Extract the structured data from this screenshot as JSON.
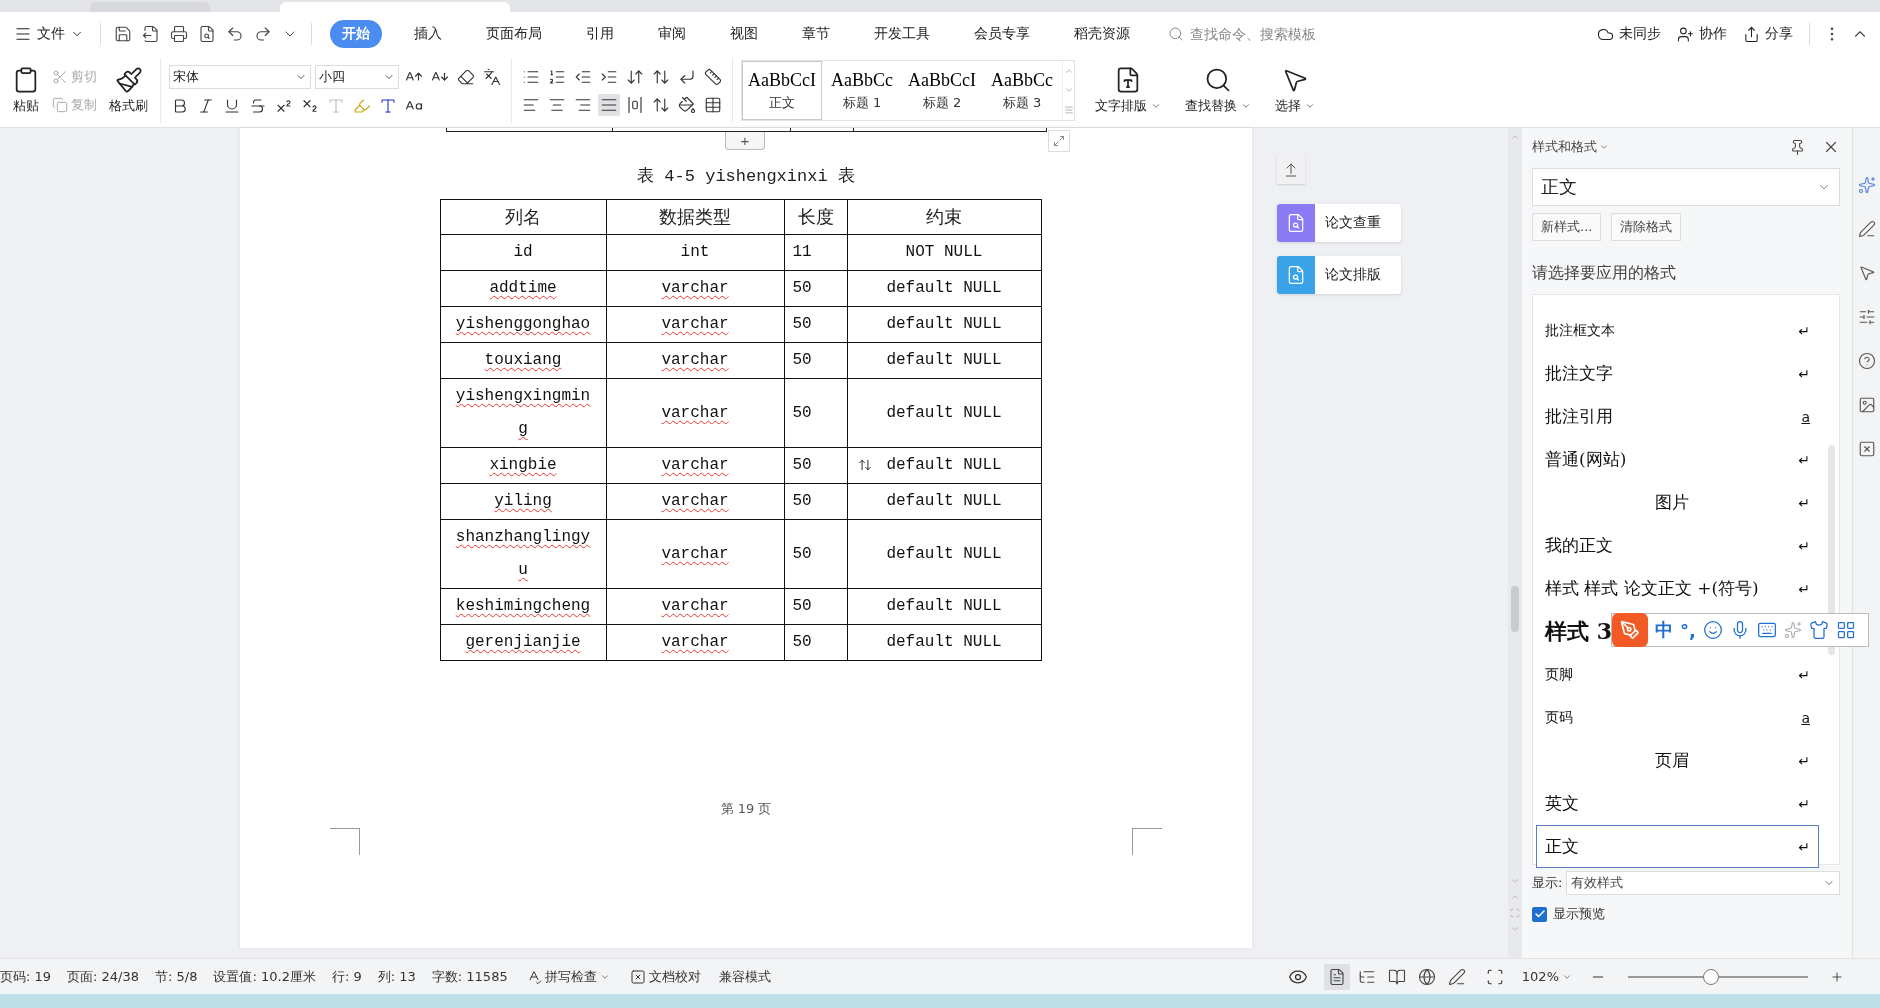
{
  "menu": {
    "file": "文件",
    "tabs": [
      {
        "label": "开始",
        "selected": true
      },
      {
        "label": "插入",
        "selected": false
      },
      {
        "label": "页面布局",
        "selected": false
      },
      {
        "label": "引用",
        "selected": false
      },
      {
        "label": "审阅",
        "selected": false
      },
      {
        "label": "视图",
        "selected": false
      },
      {
        "label": "章节",
        "selected": false
      },
      {
        "label": "开发工具",
        "selected": false
      },
      {
        "label": "会员专享",
        "selected": false
      },
      {
        "label": "稻壳资源",
        "selected": false
      }
    ],
    "search": {
      "placeholder": "查找命令、搜索模板"
    },
    "actions": [
      {
        "kind": "sync",
        "label": "未同步"
      },
      {
        "kind": "collab",
        "label": "协作"
      },
      {
        "kind": "share",
        "label": "分享"
      }
    ]
  },
  "ribbon": {
    "clipboard": {
      "paste": "粘贴",
      "cut": {
        "label": "剪切",
        "disabled": true
      },
      "copy": {
        "label": "复制",
        "disabled": true
      },
      "painter": "格式刷"
    },
    "font": {
      "name": "宋体",
      "size": "小四"
    },
    "align": [
      {
        "kind": "left",
        "selected": false
      },
      {
        "kind": "center",
        "selected": false
      },
      {
        "kind": "right",
        "selected": false
      },
      {
        "kind": "justify",
        "selected": true
      },
      {
        "kind": "distributed",
        "selected": false
      }
    ],
    "styles": [
      {
        "preview": "AaBbCcI",
        "label": "正文",
        "selected": true
      },
      {
        "preview": "AaBbCc",
        "label": "标题 1",
        "selected": false
      },
      {
        "preview": "AaBbCcI",
        "label": "标题 2",
        "selected": false
      },
      {
        "preview": "AaBbCc",
        "label": "标题 3",
        "selected": false
      }
    ],
    "tools": [
      {
        "kind": "layout",
        "label": "文字排版"
      },
      {
        "kind": "find",
        "label": "查找替换"
      },
      {
        "kind": "select",
        "label": "选择"
      }
    ]
  },
  "document": {
    "add_row": "+",
    "caption": "表 4-5 yishengxinxi 表",
    "columns": [
      "列名",
      "数据类型",
      "长度",
      "约束"
    ],
    "rows": [
      [
        {
          "text": "id",
          "flagged": false
        },
        {
          "text": "int",
          "flagged": false
        },
        {
          "text": "11",
          "flagged": false
        },
        {
          "text": "NOT NULL",
          "flagged": false
        }
      ],
      [
        {
          "text": "addtime",
          "flagged": true
        },
        {
          "text": "varchar",
          "flagged": true
        },
        {
          "text": "50",
          "flagged": false
        },
        {
          "text": "default NULL",
          "flagged": false
        }
      ],
      [
        {
          "text": "yishenggonghao",
          "flagged": true
        },
        {
          "text": "varchar",
          "flagged": true
        },
        {
          "text": "50",
          "flagged": false
        },
        {
          "text": "default NULL",
          "flagged": false
        }
      ],
      [
        {
          "text": "touxiang",
          "flagged": true
        },
        {
          "text": "varchar",
          "flagged": true
        },
        {
          "text": "50",
          "flagged": false
        },
        {
          "text": "default NULL",
          "flagged": false
        }
      ],
      [
        {
          "text": "yishengxingming",
          "flagged": true
        },
        {
          "text": "varchar",
          "flagged": true
        },
        {
          "text": "50",
          "flagged": false
        },
        {
          "text": "default NULL",
          "flagged": false
        }
      ],
      [
        {
          "text": "xingbie",
          "flagged": true
        },
        {
          "text": "varchar",
          "flagged": true
        },
        {
          "text": "50",
          "flagged": false
        },
        {
          "text": "default NULL",
          "flagged": false
        }
      ],
      [
        {
          "text": "yiling",
          "flagged": true
        },
        {
          "text": "varchar",
          "flagged": true
        },
        {
          "text": "50",
          "flagged": false
        },
        {
          "text": "default NULL",
          "flagged": false
        }
      ],
      [
        {
          "text": "shanzhanglingyu",
          "flagged": true
        },
        {
          "text": "varchar",
          "flagged": true
        },
        {
          "text": "50",
          "flagged": false
        },
        {
          "text": "default NULL",
          "flagged": false
        }
      ],
      [
        {
          "text": "keshimingcheng",
          "flagged": true
        },
        {
          "text": "varchar",
          "flagged": true
        },
        {
          "text": "50",
          "flagged": false
        },
        {
          "text": "default NULL",
          "flagged": false
        }
      ],
      [
        {
          "text": "gerenjianjie",
          "flagged": true
        },
        {
          "text": "varchar",
          "flagged": true
        },
        {
          "text": "50",
          "flagged": false
        },
        {
          "text": "default NULL",
          "flagged": false
        }
      ]
    ],
    "page_label": "第 19 页"
  },
  "side_tools": [
    {
      "label": "论文查重",
      "color": "#8b7cf6"
    },
    {
      "label": "论文排版",
      "color": "#3aa3e8"
    }
  ],
  "styles_panel": {
    "title": "样式和格式",
    "current": "正文",
    "buttons": [
      "新样式...",
      "清除格式"
    ],
    "prompt": "请选择要应用的格式",
    "items": [
      {
        "label": "批注框文本",
        "kind": "sans",
        "mark": "↵",
        "mark_underlined": false,
        "selected": false
      },
      {
        "label": "批注文字",
        "kind": "serif",
        "mark": "↵",
        "mark_underlined": false,
        "selected": false
      },
      {
        "label": "批注引用",
        "kind": "serif",
        "mark": "a",
        "mark_underlined": true,
        "selected": false
      },
      {
        "label": "普通(网站)",
        "kind": "serif",
        "mark": "↵",
        "mark_underlined": false,
        "selected": false
      },
      {
        "label": "图片",
        "kind": "center",
        "mark": "↵",
        "mark_underlined": false,
        "selected": false
      },
      {
        "label": "我的正文",
        "kind": "serif",
        "mark": "↵",
        "mark_underlined": false,
        "selected": false
      },
      {
        "label": "样式 样式 论文正文 +(符号)",
        "kind": "serif",
        "mark": "↵",
        "mark_underlined": false,
        "selected": false
      },
      {
        "label": "样式 3",
        "kind": "heading",
        "selected": false
      },
      {
        "label": "页脚",
        "kind": "sans",
        "mark": "↵",
        "mark_underlined": false,
        "selected": false
      },
      {
        "label": "页码",
        "kind": "sans",
        "mark": "a",
        "mark_underlined": true,
        "selected": false
      },
      {
        "label": "页眉",
        "kind": "center",
        "mark": "↵",
        "mark_underlined": false,
        "selected": false
      },
      {
        "label": "英文",
        "kind": "serif",
        "mark": "↵",
        "mark_underlined": false,
        "selected": false
      },
      {
        "label": "正文",
        "kind": "serif",
        "mark": "↵",
        "mark_underlined": false,
        "selected": true
      }
    ],
    "show_label": "显示:",
    "show_value": "有效样式",
    "preview": {
      "label": "显示预览",
      "checked": true
    }
  },
  "ime_toolbar": {
    "mode": "中",
    "punctuation": "°,"
  },
  "status_bar": {
    "items": [
      "页码: 19",
      "页面: 24/38",
      "节: 5/8",
      "设置值: 10.2厘米",
      "行: 9",
      "列: 13",
      "字数: 11585"
    ],
    "spell": "拼写检查",
    "proofread": "文档校对",
    "compat": "兼容模式",
    "views": [
      {
        "kind": "page",
        "selected": true
      },
      {
        "kind": "outline",
        "selected": false
      },
      {
        "kind": "read",
        "selected": false
      },
      {
        "kind": "web",
        "selected": false
      },
      {
        "kind": "write",
        "selected": false
      }
    ],
    "zoom": "102%",
    "zoom_slider": {
      "level": 0.46
    }
  }
}
